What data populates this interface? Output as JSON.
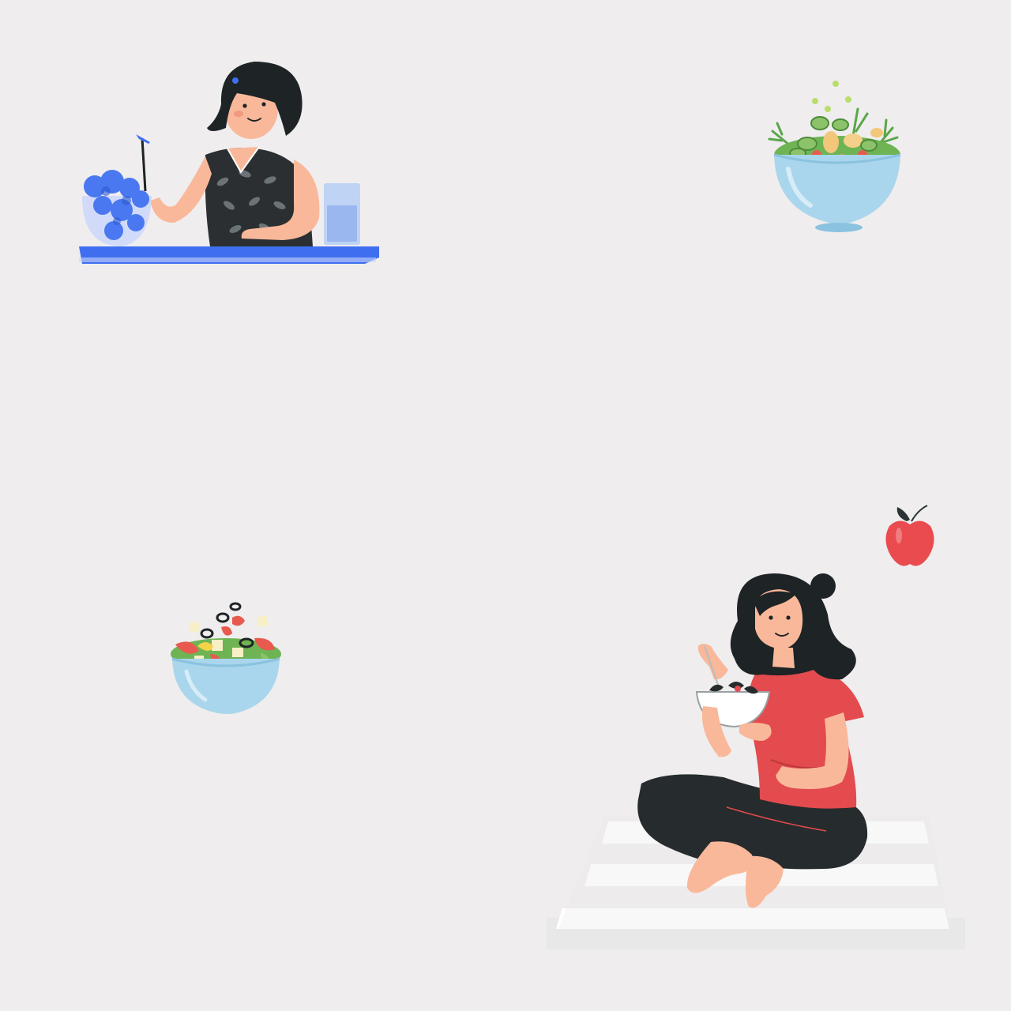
{
  "canvas": {
    "background": "#efedee"
  },
  "illustrations": [
    {
      "name": "woman-eating-salad-at-table",
      "icon": "woman-eating-icon",
      "palette": {
        "hair": "#1e2326",
        "skin": "#f9b89a",
        "dress": "#2b2f31",
        "accent": "#3f6ff0",
        "glass": "#b9cff5"
      }
    },
    {
      "name": "salad-bowl-with-greens",
      "icon": "salad-bowl-icon",
      "palette": {
        "bowl": "#a9d6ec",
        "greens": "#5aa64a",
        "cucumber": "#8cc36a",
        "tomato": "#e85a4f"
      }
    },
    {
      "name": "red-apple",
      "icon": "apple-icon",
      "palette": {
        "apple": "#e94b4e",
        "leaf": "#2b3336"
      }
    },
    {
      "name": "greek-salad-bowl",
      "icon": "greek-salad-icon",
      "palette": {
        "bowl": "#a9d6ec",
        "olive": "#1f2427",
        "feta": "#f7efc6",
        "pepper": "#e85a4f"
      }
    },
    {
      "name": "woman-sitting-eating-salad",
      "icon": "sitting-woman-icon",
      "palette": {
        "hair": "#1e2326",
        "skin": "#f9b89a",
        "shirt": "#e34b4e",
        "pants": "#262b2d",
        "mat": "#ffffff"
      }
    }
  ]
}
